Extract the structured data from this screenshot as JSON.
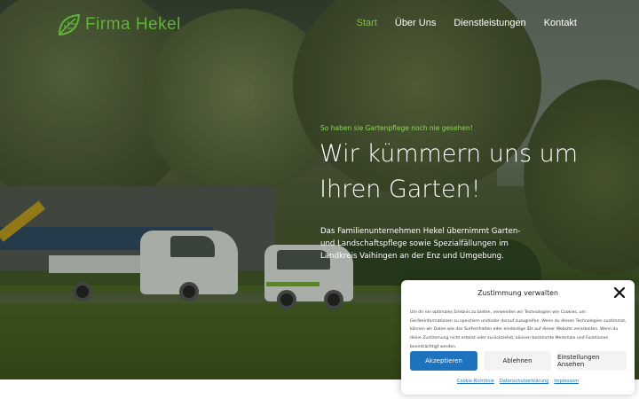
{
  "header": {
    "brand": "Firma Hekel",
    "nav": [
      "Start",
      "Über Uns",
      "Dienstleistungen",
      "Kontakt"
    ],
    "active_nav": "Start"
  },
  "hero": {
    "kicker": "So haben sie Gartenpflege noch nie gesehen!",
    "headline": "Wir kümmern uns um Ihren Garten!",
    "intro": "Das Familienunternehmen Hekel übernimmt Garten- und Landschaftspflege sowie Spezialfällungen im Landkreis Vaihingen an der Enz und Umgebung.",
    "background_image": "photo of company trucks and van parked on grass in front of trees"
  },
  "cookie_banner": {
    "title": "Zustimmung verwalten",
    "text": "Um dir ein optimales Erlebnis zu bieten, verwenden wir Technologien wie Cookies, um Geräteinformationen zu speichern und/oder darauf zuzugreifen. Wenn du diesen Technologien zustimmst, können wir Daten wie das Surfverhalten oder eindeutige IDs auf dieser Website verarbeiten. Wenn du deine Zustimmung nicht erteilst oder zurückziehst, können bestimmte Merkmale und Funktionen beeinträchtigt werden.",
    "accept": "Akzeptieren",
    "deny": "Ablehnen",
    "settings": "Einstellungen Ansehen",
    "links": [
      "Cookie-Richtlinie",
      "Datenschutzerklärung",
      "Impressum"
    ]
  },
  "colors": {
    "brand_green": "#5fb336",
    "active_nav": "#7ec04a",
    "kicker": "#8fd45a",
    "accept_button": "#1e73be",
    "link": "#1e73be"
  },
  "icons": {
    "logo": "leaf-logo-icon",
    "close": "close-icon"
  }
}
